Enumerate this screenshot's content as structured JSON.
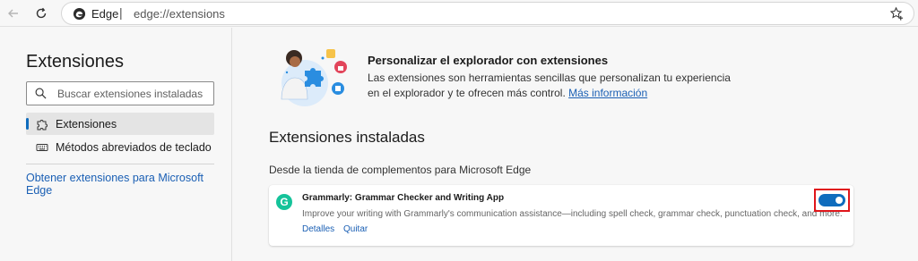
{
  "toolbar": {
    "back_icon": "back-arrow-icon",
    "refresh_icon": "refresh-icon",
    "address": {
      "brand": "Edge",
      "separator": "|",
      "url": "edge://extensions",
      "favorite_icon": "star-plus-icon"
    }
  },
  "sidebar": {
    "title": "Extensiones",
    "search_placeholder": "Buscar extensiones instaladas",
    "items": [
      {
        "label": "Extensiones",
        "icon": "puzzle-icon",
        "active": true
      },
      {
        "label": "Métodos abreviados de teclado",
        "icon": "keyboard-icon",
        "active": false
      }
    ],
    "link": "Obtener extensiones para Microsoft Edge"
  },
  "main": {
    "promo": {
      "title": "Personalizar el explorador con extensiones",
      "text": "Las extensiones son herramientas sencillas que personalizan tu experiencia en el explorador y te ofrecen más control.",
      "link": "Más información"
    },
    "installed_title": "Extensiones instaladas",
    "source_label": "Desde la tienda de complementos para Microsoft Edge",
    "extension": {
      "name": "Grammarly: Grammar Checker and Writing App",
      "description": "Improve your writing with Grammarly's communication assistance—including spell check, grammar check, punctuation check, and more.",
      "details_label": "Detalles",
      "remove_label": "Quitar",
      "enabled": true,
      "logo_letter": "G"
    }
  },
  "colors": {
    "accent": "#0f6cbd",
    "link": "#1a5fb4",
    "grammarly": "#15c39a",
    "highlight_box": "#e0161b"
  }
}
